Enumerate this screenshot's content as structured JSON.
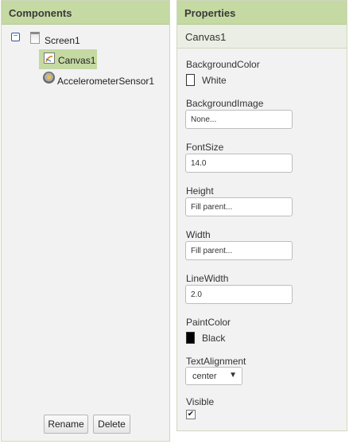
{
  "components": {
    "title": "Components",
    "tree": {
      "screen": "Screen1",
      "canvas": "Canvas1",
      "accelerometer": "AccelerometerSensor1"
    },
    "buttons": {
      "rename": "Rename",
      "delete": "Delete"
    }
  },
  "properties": {
    "title": "Properties",
    "selected": "Canvas1",
    "background_color": {
      "label": "BackgroundColor",
      "value": "White",
      "color": "#ffffff"
    },
    "background_image": {
      "label": "BackgroundImage",
      "value": "None..."
    },
    "font_size": {
      "label": "FontSize",
      "value": "14.0"
    },
    "height": {
      "label": "Height",
      "value": "Fill parent..."
    },
    "width": {
      "label": "Width",
      "value": "Fill parent..."
    },
    "line_width": {
      "label": "LineWidth",
      "value": "2.0"
    },
    "paint_color": {
      "label": "PaintColor",
      "value": "Black",
      "color": "#000000"
    },
    "text_alignment": {
      "label": "TextAlignment",
      "value": "center"
    },
    "visible": {
      "label": "Visible",
      "checked": true
    }
  },
  "colors": {
    "header": "#c5d9a3",
    "selection": "#c5d9a3",
    "panel": "#f2f2f2"
  }
}
